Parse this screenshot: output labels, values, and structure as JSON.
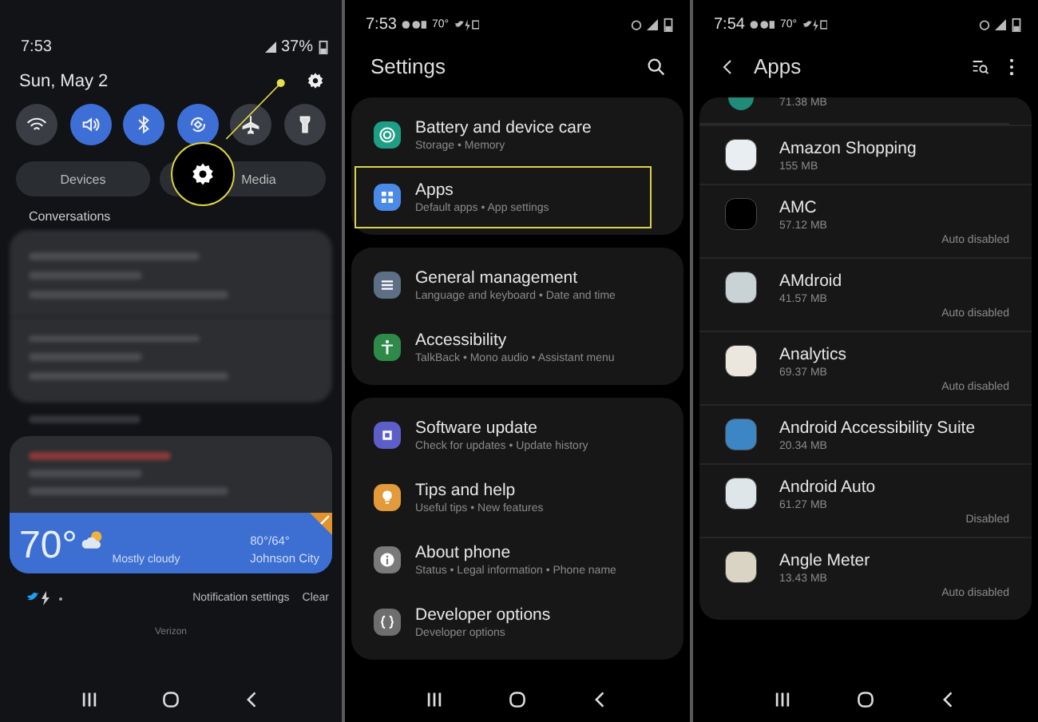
{
  "notification_panel": {
    "status_bar": {
      "time": "7:53",
      "battery": "37%"
    },
    "date": "Sun, May 2",
    "quick_toggles": [
      {
        "kind": "wifi",
        "on": false
      },
      {
        "kind": "sound",
        "on": true
      },
      {
        "kind": "bluetooth",
        "on": true
      },
      {
        "kind": "rotate",
        "on": true
      },
      {
        "kind": "airplane",
        "on": false
      },
      {
        "kind": "flashlight",
        "on": false
      }
    ],
    "buttons": [
      "Devices",
      "Media"
    ],
    "section_label": "Conversations",
    "weather": {
      "temperature": "70°",
      "condition": "Mostly cloudy",
      "high_low": "80°/64°",
      "location": "Johnson City"
    },
    "footer_buttons": [
      "Notification settings",
      "Clear"
    ],
    "carrier": "Verizon"
  },
  "settings_screen": {
    "status_bar": {
      "time": "7:53",
      "temperature": "70°"
    },
    "title": "Settings",
    "groups": [
      [
        {
          "kind": "battery",
          "title": "Battery and device care",
          "subtitle": "Storage  •  Memory",
          "color": "#1f9e86",
          "highlighted": false
        },
        {
          "kind": "apps",
          "title": "Apps",
          "subtitle": "Default apps  •  App settings",
          "color": "#4a8be8",
          "highlighted": true
        }
      ],
      [
        {
          "kind": "general",
          "title": "General management",
          "subtitle": "Language and keyboard  •  Date and time",
          "color": "#5d6f86",
          "highlighted": false
        },
        {
          "kind": "accessibility",
          "title": "Accessibility",
          "subtitle": "TalkBack  •  Mono audio  •  Assistant menu",
          "color": "#2f8a4a",
          "highlighted": false
        }
      ],
      [
        {
          "kind": "update",
          "title": "Software update",
          "subtitle": "Check for updates  •  Update history",
          "color": "#5b5fc7",
          "highlighted": false
        },
        {
          "kind": "tips",
          "title": "Tips and help",
          "subtitle": "Useful tips  •  New features",
          "color": "#e39a3b",
          "highlighted": false
        },
        {
          "kind": "about",
          "title": "About phone",
          "subtitle": "Status  •  Legal information  •  Phone name",
          "color": "#7a7a7a",
          "highlighted": false
        },
        {
          "kind": "developer",
          "title": "Developer options",
          "subtitle": "Developer options",
          "color": "#6e6e6e",
          "highlighted": false
        }
      ]
    ]
  },
  "apps_screen": {
    "status_bar": {
      "time": "7:54",
      "temperature": "70°"
    },
    "title": "Apps",
    "partial_row_size": "71.38 MB",
    "apps": [
      {
        "name": "Amazon Shopping",
        "size": "155 MB",
        "color": "#e8eef2"
      },
      {
        "name": "AMC",
        "size": "57.12 MB",
        "status": "Auto disabled",
        "color": "#000000"
      },
      {
        "name": "AMdroid",
        "size": "41.57 MB",
        "status": "Auto disabled",
        "color": "#c9d3d6"
      },
      {
        "name": "Analytics",
        "size": "69.37 MB",
        "status": "Auto disabled",
        "color": "#ece7de"
      },
      {
        "name": "Android Accessibility Suite",
        "size": "20.34 MB",
        "color": "#3d86c6"
      },
      {
        "name": "Android Auto",
        "size": "61.27 MB",
        "status": "Disabled",
        "color": "#dfe6ea"
      },
      {
        "name": "Angle Meter",
        "size": "13.43 MB",
        "status": "Auto disabled",
        "color": "#d9d4c4"
      }
    ]
  }
}
